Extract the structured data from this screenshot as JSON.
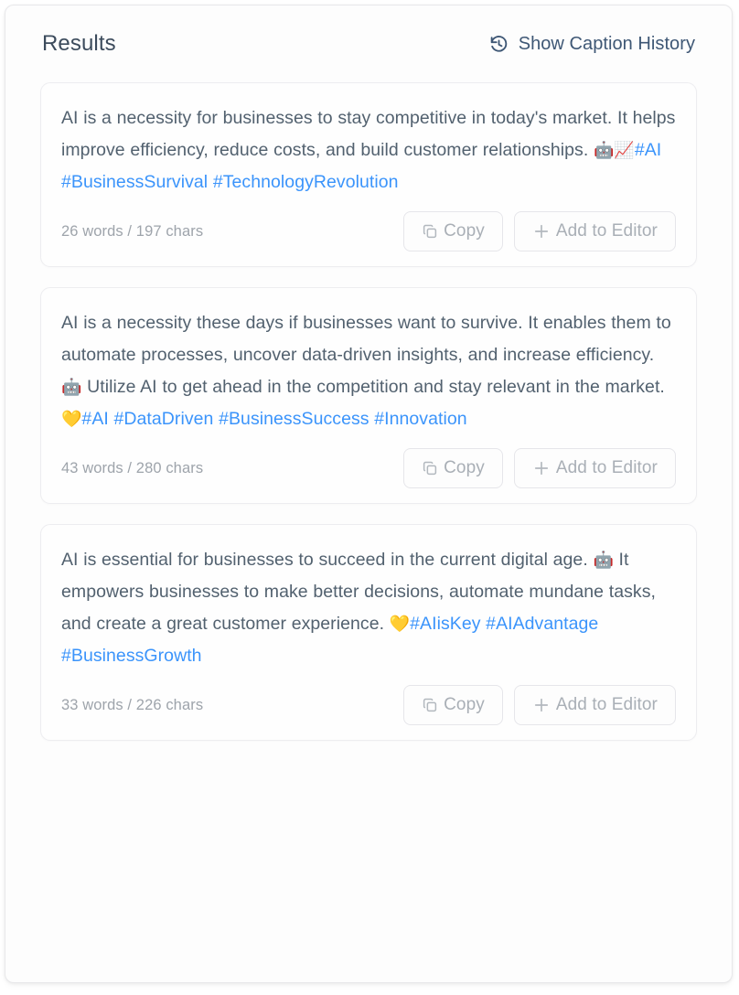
{
  "header": {
    "title": "Results",
    "history_button": {
      "label": "Show Caption History",
      "icon": "history-clock-icon"
    }
  },
  "buttons": {
    "copy_label": "Copy",
    "copy_icon": "copy-icon",
    "add_to_editor_label": "Add to Editor",
    "add_to_editor_icon": "plus-icon"
  },
  "colors": {
    "hashtag_blue": "#3b94fb",
    "title_text": "#3c4b5c",
    "body_text": "#52616f",
    "muted_text": "#9ea4ab",
    "card_border": "#ededf0",
    "panel_border": "#e8e8ea"
  },
  "results": [
    {
      "body": "AI is a necessity for businesses to stay competitive in today's market. It helps improve efficiency, reduce costs, and build customer relationships. ",
      "emojis": "🤖📈",
      "hashtags": "#AI #BusinessSurvival #TechnologyRevolution",
      "stats": "26 words / 197 chars",
      "word_count": 26,
      "char_count": 197
    },
    {
      "body_part1": "AI is a necessity these days if businesses want to survive. It enables them to automate processes, uncover data-driven insights, and increase efficiency. ",
      "emoji1": "🤖",
      "body_part2": " Utilize AI to get ahead in the competition and stay relevant in the market. ",
      "emoji2": "💛",
      "hashtags": "#AI #DataDriven #BusinessSuccess #Innovation",
      "stats": "43 words / 280 chars",
      "word_count": 43,
      "char_count": 280
    },
    {
      "body_part1": "AI is essential for businesses to succeed in the current digital age. ",
      "emoji1": "🤖",
      "body_part2": " It empowers businesses to make better decisions, automate mundane tasks, and create a great customer experience. ",
      "emoji2": "💛",
      "hashtags": "#AIisKey #AIAdvantage #BusinessGrowth",
      "stats": "33 words / 226 chars",
      "word_count": 33,
      "char_count": 226
    }
  ]
}
